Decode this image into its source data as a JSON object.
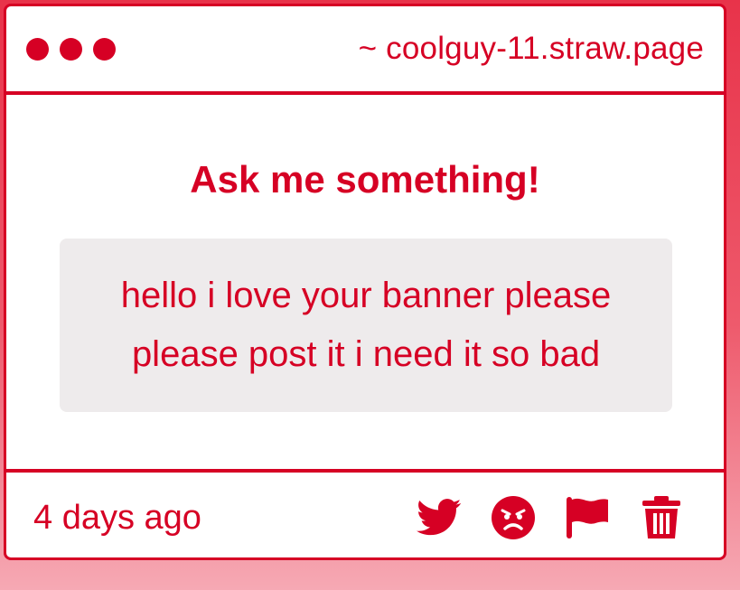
{
  "window": {
    "host": "~ coolguy-11.straw.page",
    "dots": [
      "dot",
      "dot",
      "dot"
    ]
  },
  "card": {
    "heading": "Ask me something!",
    "question": "hello i love your banner please please post it i need it so bad"
  },
  "footer": {
    "timestamp": "4 days ago",
    "actions": [
      {
        "name": "twitter-icon"
      },
      {
        "name": "angry-face-icon"
      },
      {
        "name": "flag-icon"
      },
      {
        "name": "trash-icon"
      }
    ]
  },
  "colors": {
    "accent": "#d60024",
    "background": "#e8334a",
    "question_bg": "#eeebec"
  }
}
